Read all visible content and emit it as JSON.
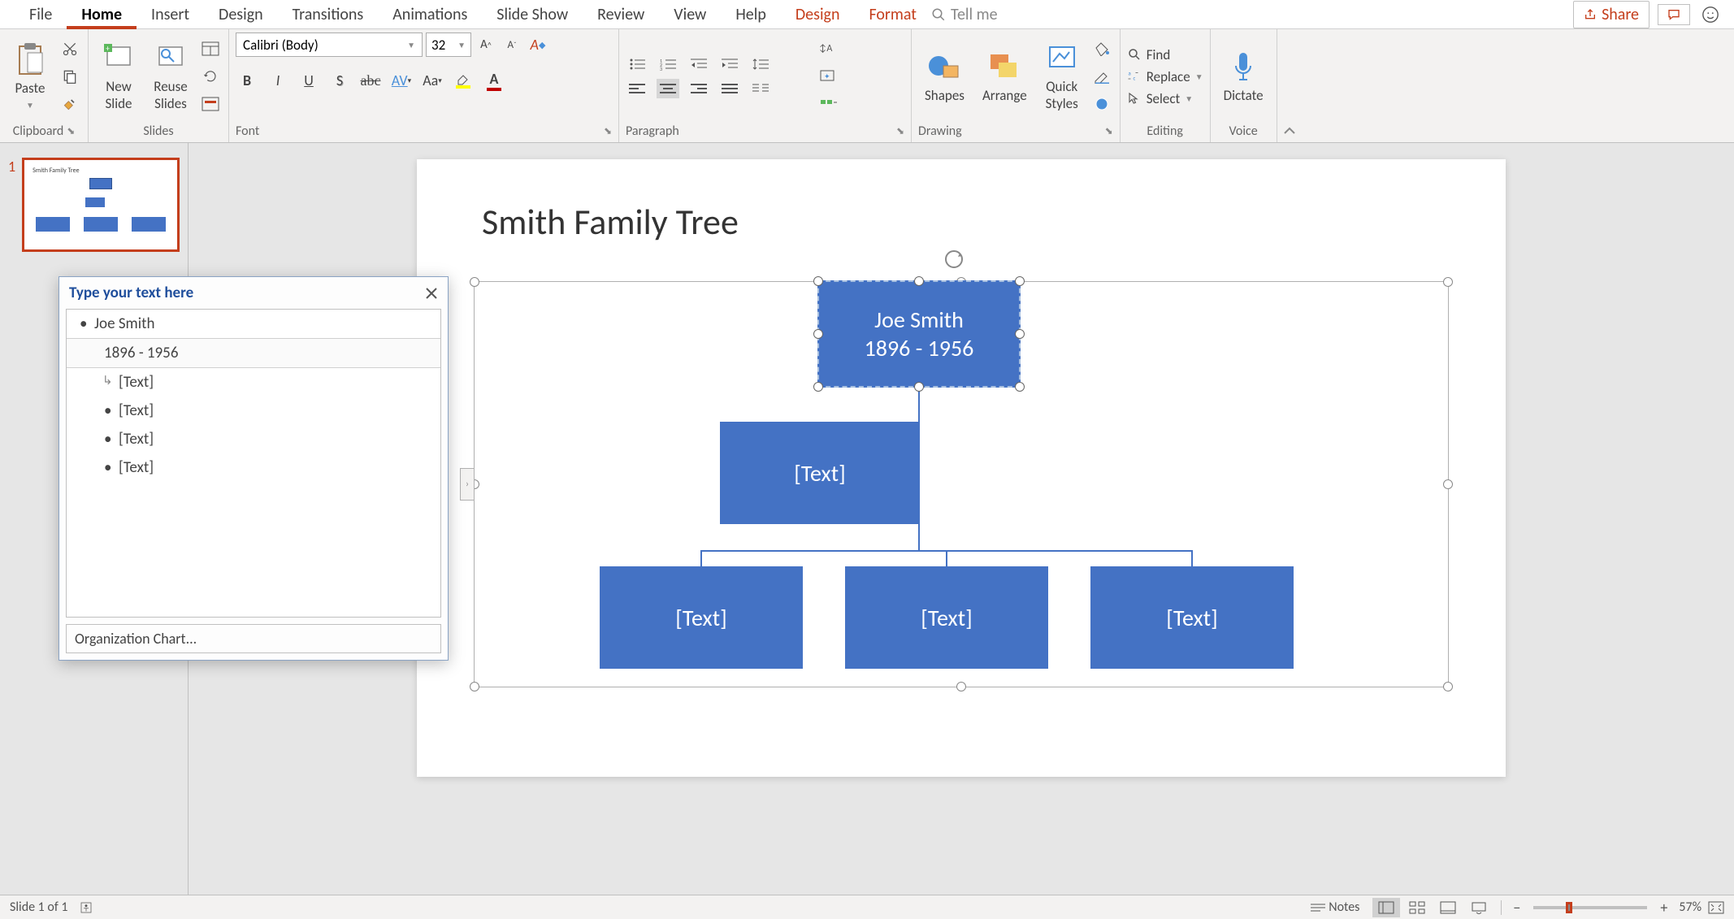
{
  "tabs": {
    "file": "File",
    "home": "Home",
    "insert": "Insert",
    "design": "Design",
    "transitions": "Transitions",
    "animations": "Animations",
    "slideshow": "Slide Show",
    "review": "Review",
    "view": "View",
    "help": "Help",
    "ctx_design": "Design",
    "ctx_format": "Format",
    "tellme": "Tell me",
    "share": "Share"
  },
  "ribbon": {
    "clipboard": {
      "paste": "Paste",
      "label": "Clipboard"
    },
    "slides": {
      "new_slide": "New\nSlide",
      "reuse": "Reuse\nSlides",
      "label": "Slides"
    },
    "font": {
      "name": "Calibri (Body)",
      "size": "32",
      "label": "Font"
    },
    "font_buttons": {
      "bold": "B",
      "italic": "I",
      "underline": "U",
      "shadow": "S",
      "strike": "abc",
      "spacing": "AV",
      "case": "Aa",
      "clear": "A"
    },
    "paragraph": {
      "label": "Paragraph"
    },
    "drawing": {
      "shapes": "Shapes",
      "arrange": "Arrange",
      "quick": "Quick\nStyles",
      "label": "Drawing"
    },
    "editing": {
      "find": "Find",
      "replace": "Replace",
      "select": "Select",
      "label": "Editing"
    },
    "voice": {
      "dictate": "Dictate",
      "label": "Voice"
    }
  },
  "slide": {
    "number": "1",
    "title": "Smith Family Tree",
    "nodes": {
      "top_line1": "Joe Smith",
      "top_line2": "1896 - 1956",
      "assistant": "[Text]",
      "child1": "[Text]",
      "child2": "[Text]",
      "child3": "[Text]"
    }
  },
  "textpane": {
    "title": "Type your text here",
    "items": {
      "l1": "Joe Smith",
      "l2": "1896 - 1956",
      "l3": "[Text]",
      "l4": "[Text]",
      "l5": "[Text]",
      "l6": "[Text]"
    },
    "footer": "Organization Chart..."
  },
  "statusbar": {
    "slide_info": "Slide 1 of 1",
    "notes": "Notes",
    "zoom": "57%"
  },
  "colors": {
    "accent": "#c43e1c",
    "node": "#4472c4"
  }
}
